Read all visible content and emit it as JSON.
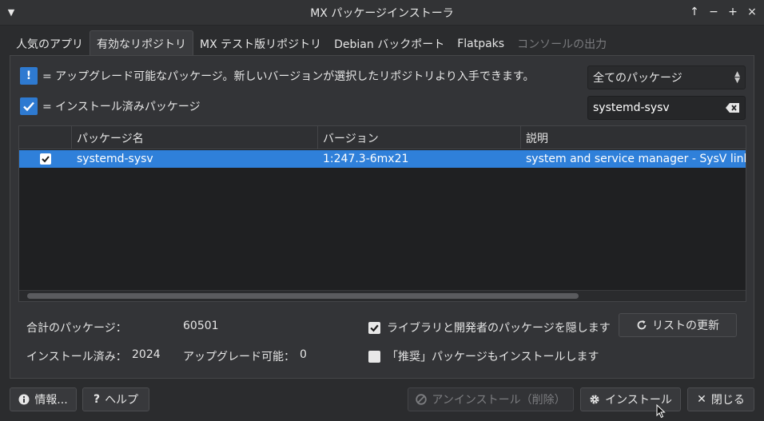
{
  "window": {
    "title": "MX パッケージインストーラ",
    "controls": [
      "↑",
      "−",
      "+",
      "×"
    ]
  },
  "tabs": [
    {
      "label": "人気のアプリ",
      "state": "normal"
    },
    {
      "label": "有効なリポジトリ",
      "state": "active"
    },
    {
      "label": "MX テスト版リポジトリ",
      "state": "normal"
    },
    {
      "label": "Debian バックポート",
      "state": "normal"
    },
    {
      "label": "Flatpaks",
      "state": "normal"
    },
    {
      "label": "コンソールの出力",
      "state": "disabled"
    }
  ],
  "legend": {
    "upgrade_symbol": "!",
    "upgrade_text": "= アップグレード可能なパッケージ。新しいバージョンが選択したリポジトリより入手できます。",
    "installed_text": "= インストール済みパッケージ"
  },
  "filter": {
    "selected": "全てのパッケージ"
  },
  "search": {
    "value": "systemd-sysv"
  },
  "table": {
    "headers": [
      "パッケージ名",
      "バージョン",
      "説明"
    ],
    "rows": [
      {
        "checked": true,
        "name": "systemd-sysv",
        "version": "1:247.3-6mx21",
        "description": "system and service manager - SysV links"
      }
    ]
  },
  "stats": {
    "total_label": "合計のパッケージ：",
    "total_value": "60501",
    "installed_label": "インストール済み：",
    "installed_value": "2024",
    "upgradable_label": "アップグレード可能：",
    "upgradable_value": "0"
  },
  "options": {
    "hide_libs_label": "ライブラリと開発者のパッケージを隠します",
    "hide_libs_checked": true,
    "install_recommends_label": "「推奨」パッケージもインストールします",
    "install_recommends_checked": false
  },
  "buttons": {
    "refresh": "リストの更新",
    "info": "情報...",
    "help": "ヘルプ",
    "uninstall": "アンインストール（削除）",
    "install": "インストール",
    "close": "閉じる"
  },
  "colors": {
    "accent": "#2f80da",
    "window_bg": "#2b2c2e"
  }
}
